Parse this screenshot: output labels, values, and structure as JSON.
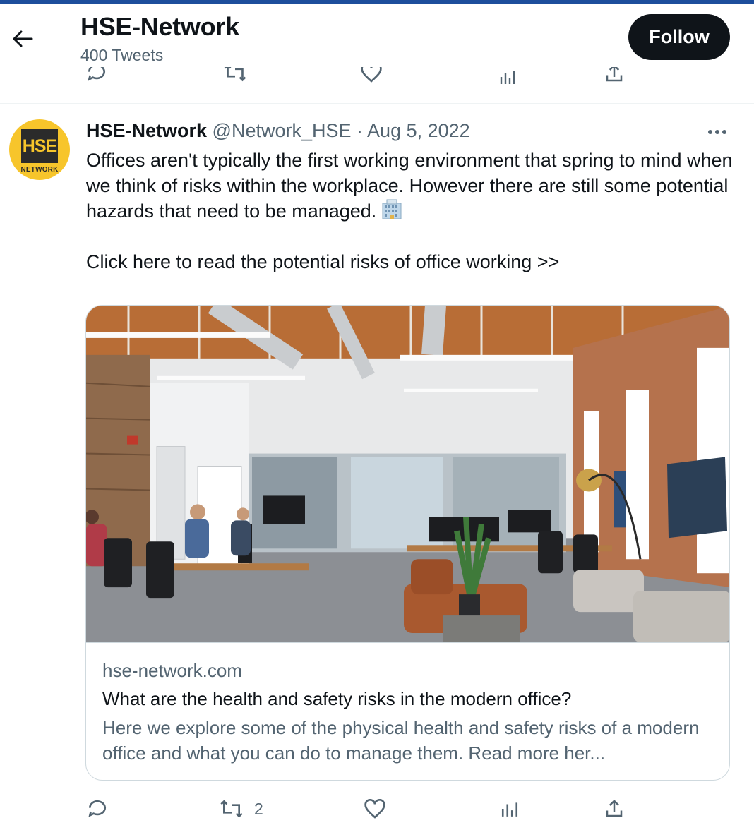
{
  "header": {
    "title": "HSE-Network",
    "tweet_count": "400 Tweets",
    "follow_label": "Follow"
  },
  "tweet": {
    "display_name": "HSE-Network",
    "handle": "@Network_HSE",
    "separator": "·",
    "date": "Aug 5, 2022",
    "avatar": {
      "logo_text": "HSE",
      "logo_subtext": "NETWORK"
    },
    "text": "Offices aren't typically the first working environment that spring to mind when we think of risks within the workplace. However there are still some potential hazards that need to be managed.",
    "cta": "Click here to read the potential risks of office working >>",
    "link_card": {
      "domain": "hse-network.com",
      "title": "What are the health and safety risks in the modern office?",
      "description": "Here we explore some of the physical health and safety risks of a modern office and what you can do to manage them. Read more her..."
    },
    "actions": {
      "reply_count": "",
      "retweet_count": "2",
      "like_count": "",
      "views_count": ""
    }
  },
  "icons": {
    "back": "arrow-left-icon",
    "more": "more-horizontal-icon",
    "reply": "reply-icon",
    "retweet": "retweet-icon",
    "like": "heart-icon",
    "views": "views-icon",
    "share": "share-icon",
    "office": "office-building-emoji"
  },
  "colors": {
    "accent_bar": "#1d4e9c",
    "text_primary": "#0f1419",
    "text_secondary": "#536471",
    "border": "#cfd9de",
    "logo_yellow": "#f7c52b",
    "follow_bg": "#0f1419"
  }
}
